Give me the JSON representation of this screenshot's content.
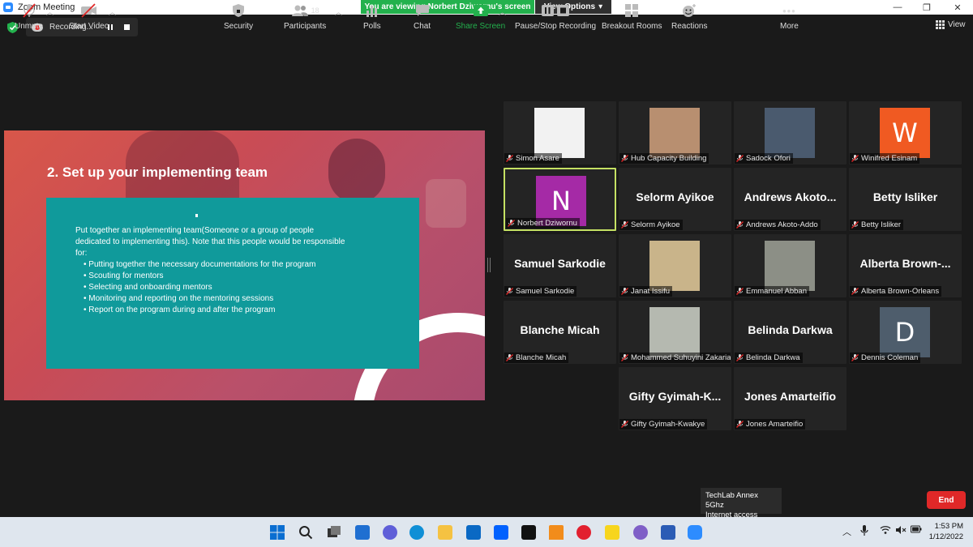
{
  "window": {
    "title": "Zoom Meeting",
    "minimize": "—",
    "maximize": "❐",
    "close": "✕"
  },
  "banner": {
    "viewing": "You are viewing Norbert Dziwornu's screen",
    "view_options": "View Options",
    "caret": "▾"
  },
  "recording": {
    "label": "Recording..."
  },
  "view_button": {
    "label": "View"
  },
  "slide": {
    "title": "2. Set up your implementing team",
    "intro": "Put together an implementing team(Someone or a group of people dedicated to implementing this). Note that this people would be responsible for:",
    "bullets": [
      "Putting together the necessary documentations for the program",
      "Scouting for mentors",
      "Selecting and onboarding mentors",
      "Monitoring and reporting on the mentoring sessions",
      "Report on the program during and after the program"
    ]
  },
  "participants_grid": [
    {
      "name": "Simon Asare",
      "kind": "photo",
      "photo_color": "#f2f2f2"
    },
    {
      "name": "Hub Capacity Building",
      "kind": "photo",
      "photo_color": "#b88f70"
    },
    {
      "name": "Sadock Ofori",
      "kind": "photo",
      "photo_color": "#4a5a6e"
    },
    {
      "name": "Winifred Esinam",
      "kind": "initial",
      "initial": "W",
      "color": "#f05a22"
    },
    {
      "name": "Norbert Dziwornu",
      "kind": "initial",
      "initial": "N",
      "color": "#a52aa6"
    },
    {
      "name": "Selorm Ayikoe",
      "kind": "text",
      "display": "Selorm Ayikoe"
    },
    {
      "name": "Andrews Akoto-Addo",
      "kind": "text",
      "display": "Andrews Akoto..."
    },
    {
      "name": "Betty Isliker",
      "kind": "text",
      "display": "Betty Isliker"
    },
    {
      "name": "Samuel Sarkodie",
      "kind": "text",
      "display": "Samuel Sarkodie"
    },
    {
      "name": "Janat Issifu",
      "kind": "photo",
      "photo_color": "#c9b48a"
    },
    {
      "name": "Emmanuel Abban",
      "kind": "photo",
      "photo_color": "#8c8f86"
    },
    {
      "name": "Alberta Brown-Orleans",
      "kind": "text",
      "display": "Alberta Brown-..."
    },
    {
      "name": "Blanche Micah",
      "kind": "text",
      "display": "Blanche Micah"
    },
    {
      "name": "Mohammed Suhuyini Zakaria",
      "kind": "photo",
      "photo_color": "#b5b9b0"
    },
    {
      "name": "Belinda Darkwa",
      "kind": "text",
      "display": "Belinda Darkwa"
    },
    {
      "name": "Dennis Coleman",
      "kind": "initial",
      "initial": "D",
      "color": "#4e5d6c"
    },
    {
      "name": "Gifty Gyimah-Kwakye",
      "kind": "text",
      "display": "Gifty Gyimah-K..."
    },
    {
      "name": "Jones Amarteifio",
      "kind": "text",
      "display": "Jones Amarteifio"
    }
  ],
  "toolbar": {
    "unmute": "Unmute",
    "start_video": "Start Video",
    "security": "Security",
    "participants": "Participants",
    "participants_count": "18",
    "polls": "Polls",
    "chat": "Chat",
    "share_screen": "Share Screen",
    "pause_stop_recording": "Pause/Stop Recording",
    "breakout_rooms": "Breakout Rooms",
    "reactions": "Reactions",
    "more": "More",
    "end": "End",
    "more_dots": "•••"
  },
  "tooltip": {
    "line1": "TechLab Annex 5Ghz",
    "line2": "Internet access"
  },
  "taskbar": {
    "time": "1:53 PM",
    "date": "1/12/2022",
    "chevron": "︿"
  },
  "colors": {
    "accent_green": "#23b14d",
    "end_red": "#e02828",
    "active_border": "#c5e163",
    "slide_teal": "#109a9b"
  }
}
